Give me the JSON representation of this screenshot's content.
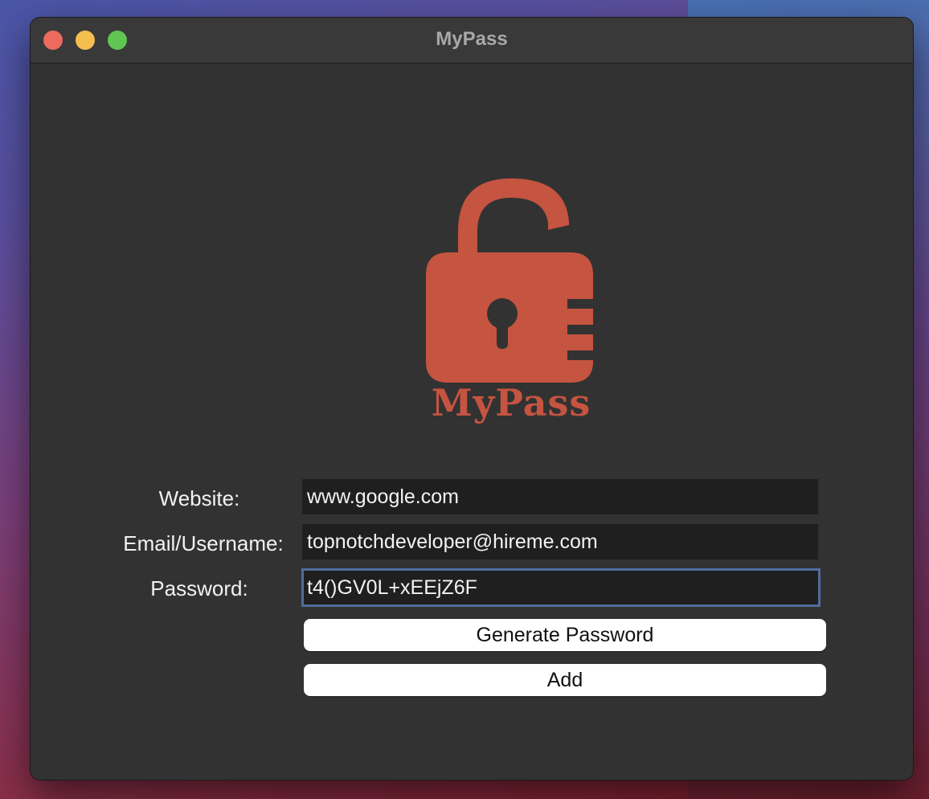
{
  "window": {
    "title": "MyPass"
  },
  "logo": {
    "icon": "padlock-icon",
    "text": "MyPass",
    "color": "#c55440"
  },
  "form": {
    "website_label": "Website:",
    "website_value": "www.google.com",
    "email_label": "Email/Username:",
    "email_value": "topnotchdeveloper@hireme.com",
    "password_label": "Password:",
    "password_value": "t4()GV0L+xEEjZ6F"
  },
  "buttons": {
    "generate_label": "Generate Password",
    "add_label": "Add"
  },
  "colors": {
    "window_bg": "#323232",
    "field_bg": "#1f1f1f",
    "focus_ring": "#4f6d9c"
  }
}
